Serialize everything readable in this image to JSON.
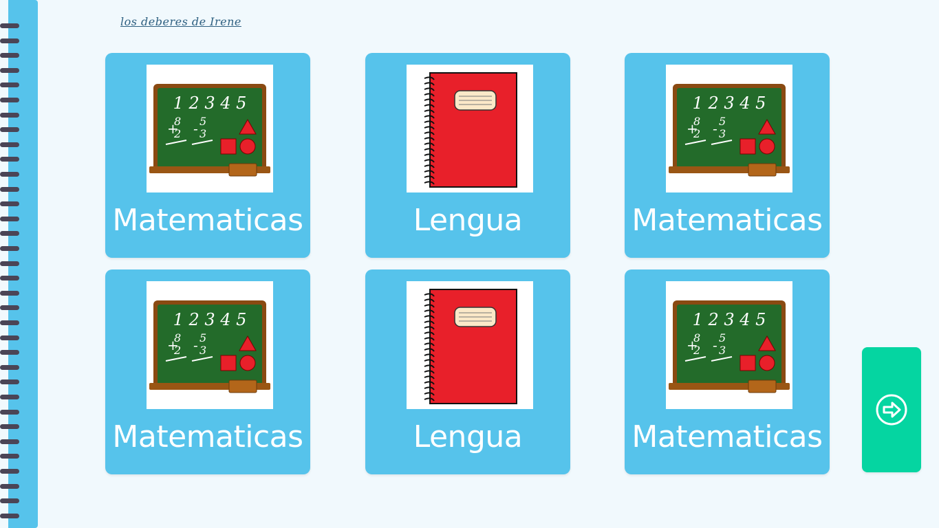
{
  "header": {
    "title_link": "los deberes de Irene"
  },
  "cards": [
    {
      "label": "Matematicas",
      "icon": "chalkboard-icon"
    },
    {
      "label": "Lengua",
      "icon": "notebook-icon"
    },
    {
      "label": "Matematicas",
      "icon": "chalkboard-icon"
    },
    {
      "label": "Matematicas",
      "icon": "chalkboard-icon"
    },
    {
      "label": "Lengua",
      "icon": "notebook-icon"
    },
    {
      "label": "Matematicas",
      "icon": "chalkboard-icon"
    }
  ],
  "chalkboard_text": {
    "numbers": "1 2 3 4 5",
    "add_top": "8",
    "add_bottom": "2",
    "sub_top": "5",
    "sub_bottom": "3"
  },
  "navigation": {
    "next_icon": "arrow-right-circle-icon"
  },
  "colors": {
    "background": "#f1f9fd",
    "card": "#56c3eb",
    "spine": "#56c3eb",
    "rings": "#4b4556",
    "next_button": "#05d5a1",
    "chalkboard": "#236b2a",
    "notebook": "#e8202a"
  }
}
